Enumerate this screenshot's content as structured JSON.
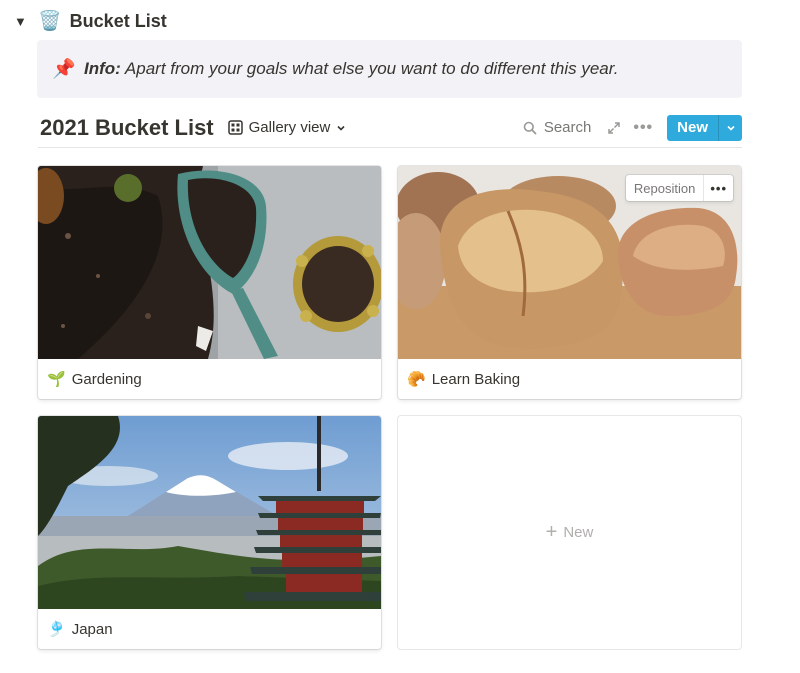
{
  "toggle": {
    "arrow": "▼",
    "emoji": "🗑️",
    "title": "Bucket List"
  },
  "callout": {
    "icon": "📌",
    "label": "Info:",
    "text": " Apart from your goals what else you want to do different this year."
  },
  "database": {
    "title": "2021 Bucket List",
    "view_label": "Gallery view",
    "search_label": "Search",
    "more_label": "•••",
    "new_label": "New"
  },
  "cards": [
    {
      "emoji": "🌱",
      "title": "Gardening",
      "image": "soil-trowel-photo"
    },
    {
      "emoji": "🥐",
      "title": "Learn Baking",
      "image": "bread-loaves-photo",
      "reposition_label": "Reposition",
      "reposition_more": "•••"
    },
    {
      "emoji": "🎐",
      "title": "Japan",
      "image": "mount-fuji-pagoda-photo"
    }
  ],
  "new_card": {
    "plus": "+",
    "label": "New"
  },
  "colors": {
    "accent": "#2eaadc",
    "text": "#37352f",
    "muted": "#787774",
    "callout_bg": "#f3f2f7"
  }
}
